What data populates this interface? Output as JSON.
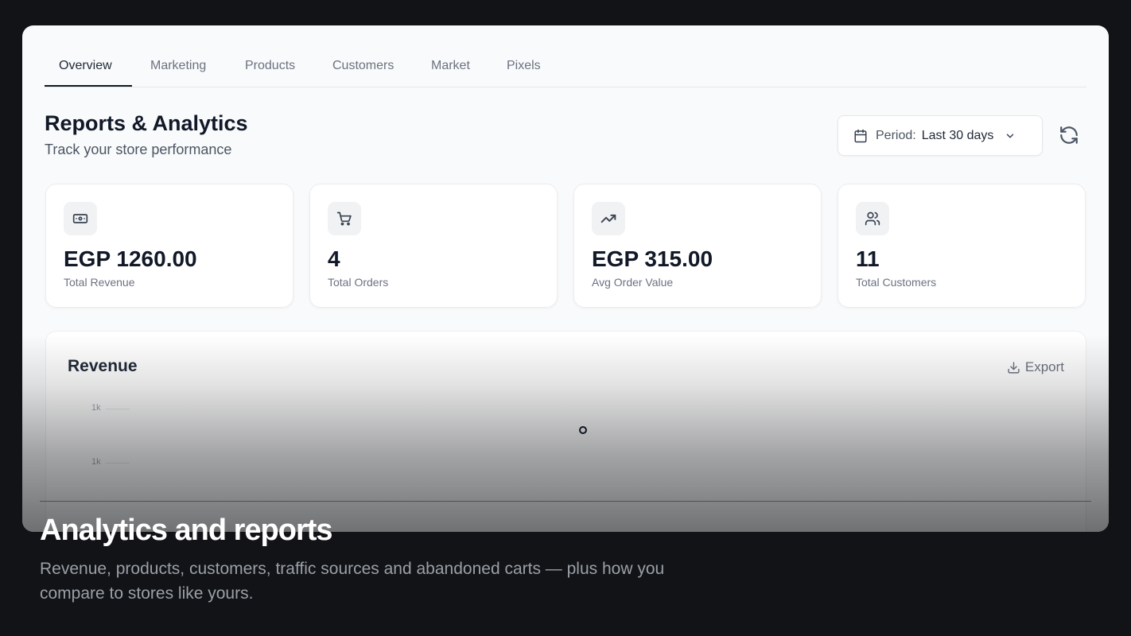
{
  "tabs": [
    {
      "label": "Overview",
      "active": true
    },
    {
      "label": "Marketing",
      "active": false
    },
    {
      "label": "Products",
      "active": false
    },
    {
      "label": "Customers",
      "active": false
    },
    {
      "label": "Market",
      "active": false
    },
    {
      "label": "Pixels",
      "active": false
    }
  ],
  "header": {
    "title": "Reports & Analytics",
    "subtitle": "Track your store performance"
  },
  "period": {
    "label": "Period:",
    "value": "Last 30 days",
    "icon": "calendar-icon"
  },
  "refresh_icon": "refresh-icon",
  "stats": [
    {
      "icon": "banknote-icon",
      "value": "EGP 1260.00",
      "label": "Total Revenue"
    },
    {
      "icon": "cart-icon",
      "value": "4",
      "label": "Total Orders"
    },
    {
      "icon": "trending-up-icon",
      "value": "EGP 315.00",
      "label": "Avg Order Value"
    },
    {
      "icon": "users-icon",
      "value": "11",
      "label": "Total Customers"
    }
  ],
  "revenue": {
    "title": "Revenue",
    "export_label": "Export",
    "y_ticks": [
      "1k",
      "1k"
    ]
  },
  "caption": {
    "title": "Analytics and reports",
    "description": "Revenue, products, customers, traffic sources and abandoned carts — plus how you compare to stores like yours."
  },
  "colors": {
    "background": "#111316",
    "card": "#f9fafb",
    "text_primary": "#111827",
    "text_muted": "#6b7280"
  }
}
